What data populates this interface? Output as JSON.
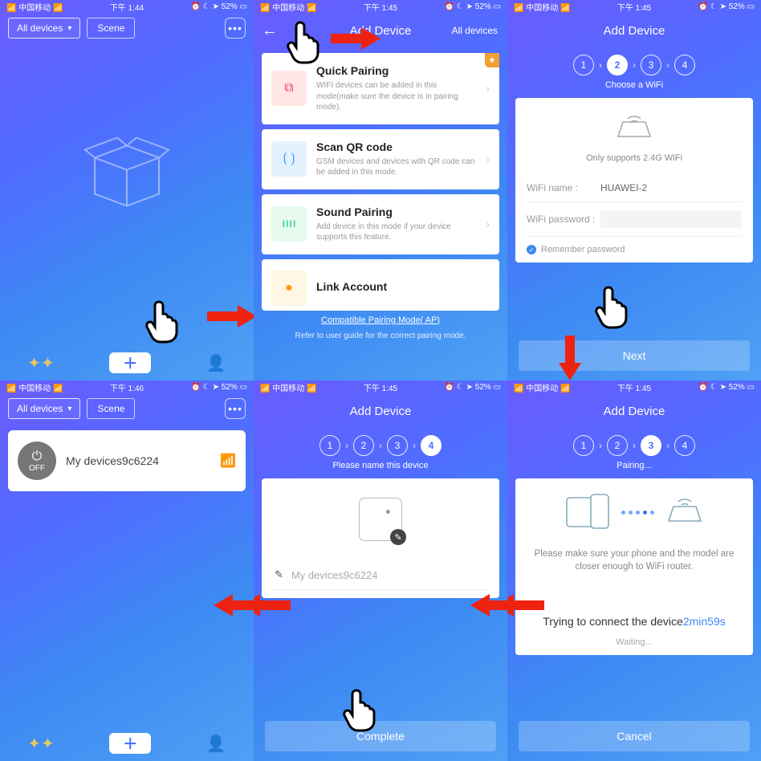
{
  "status": {
    "left": "中国移动",
    "time1": "下午 1:44",
    "time2": "下午 1:45",
    "time3": "下午 1:46",
    "batt": "52%"
  },
  "s1": {
    "all": "All devices",
    "scene": "Scene"
  },
  "s2": {
    "title": "Add Device",
    "all": "All devices",
    "c1t": "Quick Pairing",
    "c1d": "WIFI devices can be added in this mode(make sure the device is in pairing mode).",
    "c2t": "Scan QR code",
    "c2d": "GSM devices and devices with QR code can be added in this mode.",
    "c3t": "Sound Pairing",
    "c3d": "Add device in this mode if your device supports this feature.",
    "c4t": "Link Account",
    "link": "Compatible Pairing Mode( AP)",
    "hint": "Refer to user guide for the correct pairing mode."
  },
  "s3": {
    "title": "Add Device",
    "sub": "Choose a WiFi",
    "rtr": "Only supports 2.4G WiFi",
    "namel": "WiFi name :",
    "namev": "HUAWEI-2",
    "passl": "WiFi password :",
    "remember": "Remember password",
    "next": "Next"
  },
  "s4": {
    "all": "All devices",
    "scene": "Scene",
    "dev": "My devices9c6224",
    "off": "OFF"
  },
  "s5": {
    "title": "Add Device",
    "sub": "Please name this device",
    "name": "My devices9c6224",
    "complete": "Complete"
  },
  "s6": {
    "title": "Add Device",
    "sub": "Pairing...",
    "msg": "Please make sure your phone and the model are closer enough to WiFi router.",
    "trying": "Trying to connect the device",
    "time": "2min59s",
    "wait": "Waiting...",
    "cancel": "Cancel"
  }
}
